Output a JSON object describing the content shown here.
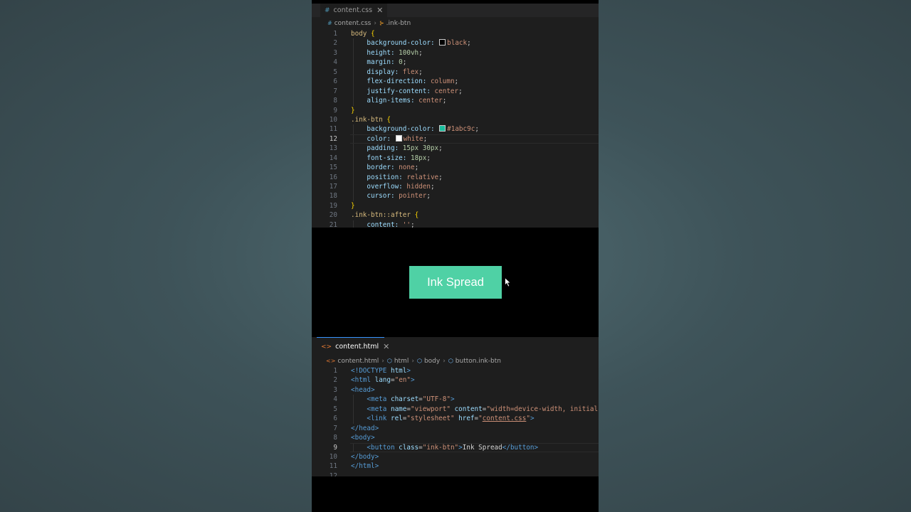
{
  "css_editor": {
    "tab": {
      "icon": "#",
      "label": "content.css",
      "close": "✕"
    },
    "breadcrumb": [
      {
        "icon": "#",
        "label": "content.css"
      },
      {
        "icon": "⊱",
        "label": ".ink-btn"
      }
    ],
    "active_line": 12,
    "lines": [
      [
        [
          "body ",
          "k-sel"
        ],
        [
          "{",
          "k-brace"
        ]
      ],
      [
        [
          "    background-color: ",
          "k-prop"
        ],
        [
          "",
          "sw:#000000"
        ],
        [
          "black",
          "k-val"
        ],
        [
          ";",
          "k-punc"
        ]
      ],
      [
        [
          "    height: ",
          "k-prop"
        ],
        [
          "100vh",
          "k-num"
        ],
        [
          ";",
          "k-punc"
        ]
      ],
      [
        [
          "    margin: ",
          "k-prop"
        ],
        [
          "0",
          "k-num"
        ],
        [
          ";",
          "k-punc"
        ]
      ],
      [
        [
          "    display: ",
          "k-prop"
        ],
        [
          "flex",
          "k-val"
        ],
        [
          ";",
          "k-punc"
        ]
      ],
      [
        [
          "    flex-direction: ",
          "k-prop"
        ],
        [
          "column",
          "k-val"
        ],
        [
          ";",
          "k-punc"
        ]
      ],
      [
        [
          "    justify-content: ",
          "k-prop"
        ],
        [
          "center",
          "k-val"
        ],
        [
          ";",
          "k-punc"
        ]
      ],
      [
        [
          "    align-items: ",
          "k-prop"
        ],
        [
          "center",
          "k-val"
        ],
        [
          ";",
          "k-punc"
        ]
      ],
      [
        [
          "}",
          "k-brace"
        ]
      ],
      [
        [
          ".ink-btn ",
          "k-sel"
        ],
        [
          "{",
          "k-brace"
        ]
      ],
      [
        [
          "    background-color: ",
          "k-prop"
        ],
        [
          "",
          "sw:#1abc9c"
        ],
        [
          "#1abc9c",
          "k-val"
        ],
        [
          ";",
          "k-punc"
        ]
      ],
      [
        [
          "    color: ",
          "k-prop"
        ],
        [
          "",
          "sw:#ffffff"
        ],
        [
          "white",
          "k-val"
        ],
        [
          ";",
          "k-punc"
        ]
      ],
      [
        [
          "    padding: ",
          "k-prop"
        ],
        [
          "15px 30px",
          "k-num"
        ],
        [
          ";",
          "k-punc"
        ]
      ],
      [
        [
          "    font-size: ",
          "k-prop"
        ],
        [
          "18px",
          "k-num"
        ],
        [
          ";",
          "k-punc"
        ]
      ],
      [
        [
          "    border: ",
          "k-prop"
        ],
        [
          "none",
          "k-val"
        ],
        [
          ";",
          "k-punc"
        ]
      ],
      [
        [
          "    position: ",
          "k-prop"
        ],
        [
          "relative",
          "k-val"
        ],
        [
          ";",
          "k-punc"
        ]
      ],
      [
        [
          "    overflow: ",
          "k-prop"
        ],
        [
          "hidden",
          "k-val"
        ],
        [
          ";",
          "k-punc"
        ]
      ],
      [
        [
          "    cursor: ",
          "k-prop"
        ],
        [
          "pointer",
          "k-val"
        ],
        [
          ";",
          "k-punc"
        ]
      ],
      [
        [
          "}",
          "k-brace"
        ]
      ],
      [
        [
          ".ink-btn::after ",
          "k-sel"
        ],
        [
          "{",
          "k-brace"
        ]
      ],
      [
        [
          "    content: ",
          "k-prop"
        ],
        [
          "''",
          "k-val"
        ],
        [
          ";",
          "k-punc"
        ]
      ]
    ]
  },
  "preview": {
    "button_label": "Ink Spread",
    "button_color": "#4fd1a5"
  },
  "html_editor": {
    "tab": {
      "icon": "<>",
      "label": "content.html",
      "close": "✕"
    },
    "breadcrumb": [
      {
        "icon": "<>",
        "label": "content.html"
      },
      {
        "icon": "⬡",
        "label": "html"
      },
      {
        "icon": "⬡",
        "label": "body"
      },
      {
        "icon": "⬡",
        "label": "button.ink-btn"
      }
    ],
    "active_line": 9,
    "lines": [
      [
        [
          "<!DOCTYPE ",
          "k-tag"
        ],
        [
          "html",
          "k-attr"
        ],
        [
          ">",
          "k-tag"
        ]
      ],
      [
        [
          "<html ",
          "k-tag"
        ],
        [
          "lang",
          "k-attr"
        ],
        [
          "=",
          "k-punc"
        ],
        [
          "\"en\"",
          "k-str"
        ],
        [
          ">",
          "k-tag"
        ]
      ],
      [
        [
          "<head>",
          "k-tag"
        ]
      ],
      [
        [
          "    <meta ",
          "k-tag"
        ],
        [
          "charset",
          "k-attr"
        ],
        [
          "=",
          "k-punc"
        ],
        [
          "\"UTF-8\"",
          "k-str"
        ],
        [
          ">",
          "k-tag"
        ]
      ],
      [
        [
          "    <meta ",
          "k-tag"
        ],
        [
          "name",
          "k-attr"
        ],
        [
          "=",
          "k-punc"
        ],
        [
          "\"viewport\" ",
          "k-str"
        ],
        [
          "content",
          "k-attr"
        ],
        [
          "=",
          "k-punc"
        ],
        [
          "\"width=device-width, initial-s",
          "k-str"
        ]
      ],
      [
        [
          "    <link ",
          "k-tag"
        ],
        [
          "rel",
          "k-attr"
        ],
        [
          "=",
          "k-punc"
        ],
        [
          "\"stylesheet\" ",
          "k-str"
        ],
        [
          "href",
          "k-attr"
        ],
        [
          "=",
          "k-punc"
        ],
        [
          "\"",
          "k-str"
        ],
        [
          "content.css",
          "k-link"
        ],
        [
          "\"",
          "k-str"
        ],
        [
          ">",
          "k-tag"
        ]
      ],
      [
        [
          "</head>",
          "k-tag"
        ]
      ],
      [
        [
          "<body>",
          "k-tag"
        ]
      ],
      [
        [
          "    <button ",
          "k-tag"
        ],
        [
          "class",
          "k-attr"
        ],
        [
          "=",
          "k-punc"
        ],
        [
          "\"ink-btn\"",
          "k-str"
        ],
        [
          ">",
          "k-tag"
        ],
        [
          "Ink Spread",
          "k-text"
        ],
        [
          "</button>",
          "k-tag"
        ]
      ],
      [
        [
          "</body>",
          "k-tag"
        ]
      ],
      [
        [
          "</html>",
          "k-tag"
        ]
      ],
      [
        [
          "",
          "k-punc"
        ]
      ]
    ]
  }
}
